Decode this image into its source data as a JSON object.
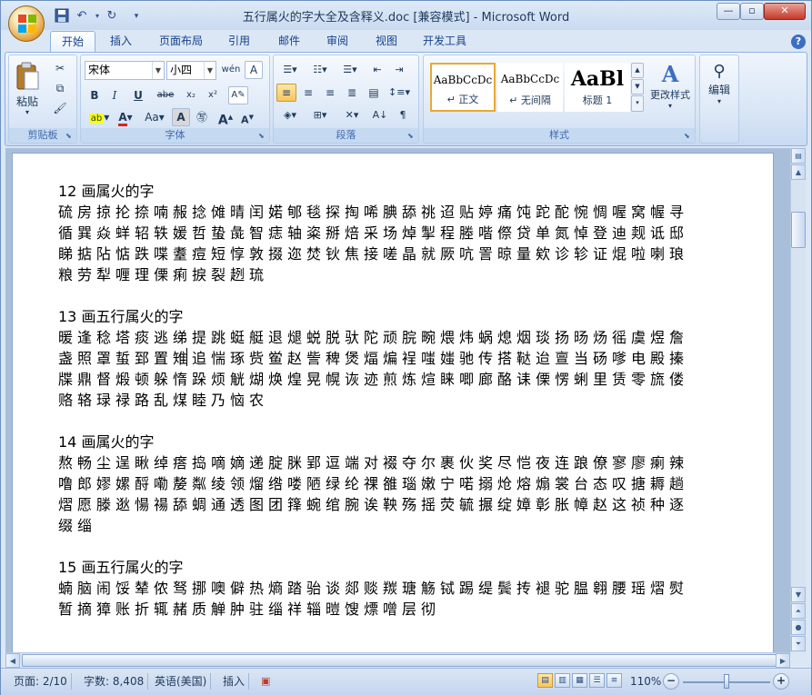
{
  "window": {
    "title": "五行属火的字大全及含释义.doc [兼容模式] - Microsoft Word",
    "minimize": "—",
    "restore": "▫",
    "close": "✕"
  },
  "quick_access": {
    "save_icon": "save-icon",
    "undo_icon": "undo-icon",
    "redo_icon": "redo-icon"
  },
  "tabs": [
    "开始",
    "插入",
    "页面布局",
    "引用",
    "邮件",
    "审阅",
    "视图",
    "开发工具"
  ],
  "ribbon": {
    "clipboard": {
      "paste": "粘贴",
      "label": "剪贴板"
    },
    "font": {
      "label": "字体",
      "font_name": "宋体",
      "font_size": "小四",
      "bold": "B",
      "italic": "I",
      "underline": "U",
      "strikethrough": "abe",
      "subscript": "x₂",
      "superscript": "x²",
      "change_case": "Aa",
      "grow": "A",
      "shrink": "A"
    },
    "paragraph": {
      "label": "段落"
    },
    "styles": {
      "label": "样式",
      "tiles": [
        {
          "sample": "AaBbCcDc",
          "name": "↵ 正文"
        },
        {
          "sample": "AaBbCcDc",
          "name": "↵ 无间隔"
        },
        {
          "sample": "AaBl",
          "name": "标题 1"
        }
      ],
      "change_styles": "更改样式"
    },
    "editing": {
      "label": "编辑"
    }
  },
  "document": {
    "paragraphs": [
      {
        "heading": "12 画属火的字",
        "chars": "硫房掠抡捺喃赧捻傩晴闰婼郇毯探掏唏腆舔祧迢贴婷痛饨跎酡惋惆喔窝幄寻循巽焱蛘轺轶媛哲蛰彘智痣轴粢掰焙采场焯掣程塍喈傺贷单氮悼登迪觌诋邸睇掂阽惦跌喋耋痘短惇敦掇迩焚钬焦接嗟晶就厥吭詈晾量欸诊轸证焜啦喇琅粮劳犁喱理傈痢捩裂趔琉"
      },
      {
        "heading": "13 画五行属火的字",
        "chars": "暖逢稔塔痰逃绨提跳蜓艇退煺蜕脱驮陀顽脘畹煨炜蜗熄烟琰扬旸炀徭虞煜詹盏照罩蜇郅置雉追惴琢赀鲎赵訾稗煲煏煸裎嗤媸驰传搭鞑迨亶当砀嗲电殿搸牒鼎督煅顿躲惰跺烦觥煳焕煌晃幌诙迹煎炼煊睐唧廊酪诔傈愣蜊里赁零旒偻赂辂琭禄路乱煤睦乃恼农"
      },
      {
        "heading": "14 画属火的字",
        "chars": "熬畅尘逞瞅绰瘩捣嘀嫡递腚脒郢逗端对裰夺尔裹伙奖尽恺夜连踉僚寥廖瘌辣噜郎嫪嫘酹嘞嫠粼绫领熘绺喽陋绿纶祼雒瑙嫩宁喏搦炝熔煽裳台态叹搪耨趟熠愿滕逖愓禓舔蜩通透图团箨蜿绾腕诶鞅殇摇荧毓搌绽嫜彰胀幛赵这祯种逐缀缁"
      },
      {
        "heading": "15 画五行属火的字",
        "chars": "蝻脑闹馁辇侬驽挪噢僻热熵踏骀谈郯赕羰瑭觞铽踢缇鬓抟褪驼腽翱腰瑶熠熨暂摘獐账折辄赭质觯肿驻缁祥辎暟馊熛噌层彻"
      }
    ]
  },
  "status_bar": {
    "page": "页面: 2/10",
    "word_count": "字数: 8,408",
    "language": "英语(美国)",
    "mode": "插入",
    "zoom": "110%",
    "zoom_out": "−",
    "zoom_in": "+"
  }
}
